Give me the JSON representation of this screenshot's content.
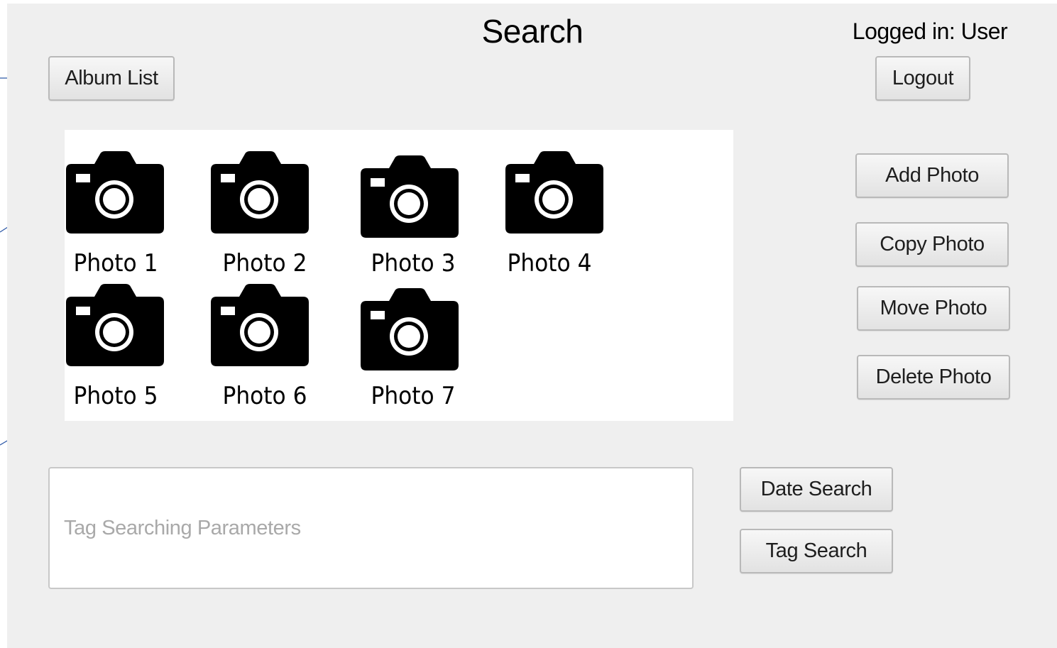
{
  "window": {
    "title": "Search",
    "login_status": "Logged in: User"
  },
  "nav": {
    "album_list_label": "Album List",
    "logout_label": "Logout"
  },
  "photos": [
    {
      "label": "Photo 1",
      "icon": "camera-icon"
    },
    {
      "label": "Photo 2",
      "icon": "camera-icon"
    },
    {
      "label": "Photo 3",
      "icon": "camera-icon"
    },
    {
      "label": "Photo 4",
      "icon": "camera-icon"
    },
    {
      "label": "Photo 5",
      "icon": "camera-icon"
    },
    {
      "label": "Photo 6",
      "icon": "camera-icon"
    },
    {
      "label": "Photo 7",
      "icon": "camera-icon"
    }
  ],
  "actions": {
    "add_photo_label": "Add Photo",
    "copy_photo_label": "Copy Photo",
    "move_photo_label": "Move Photo",
    "delete_photo_label": "Delete Photo"
  },
  "search": {
    "placeholder": "Tag Searching Parameters",
    "value": "",
    "date_search_label": "Date Search",
    "tag_search_label": "Tag Search"
  },
  "colors": {
    "window_background": "#efefef",
    "panel_background": "#ffffff",
    "annotation_line": "#2f5aa8",
    "placeholder_text": "#a9a9a9"
  }
}
